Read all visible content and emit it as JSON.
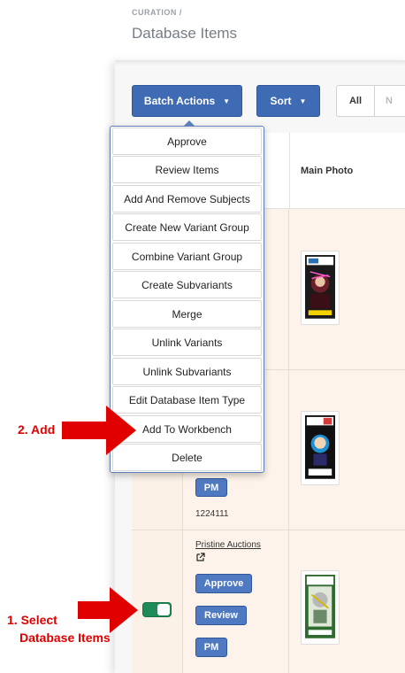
{
  "header": {
    "breadcrumb": "CURATION /",
    "title": "Database Items"
  },
  "toolbar": {
    "batch_actions": "Batch Actions",
    "sort": "Sort",
    "filter_all": "All",
    "filter_next": "N"
  },
  "table": {
    "main_photo_header": "Main Photo",
    "rows": [
      {
        "pm": "PM",
        "id": "1224111"
      },
      {
        "seller": "Pristine Auctions",
        "approve": "Approve",
        "review": "Review",
        "pm": "PM"
      }
    ]
  },
  "batch_menu": {
    "items": [
      "Approve",
      "Review Items",
      "Add And Remove Subjects",
      "Create New Variant Group",
      "Combine Variant Group",
      "Create Subvariants",
      "Merge",
      "Unlink Variants",
      "Unlink Subvariants",
      "Edit Database Item Type",
      "Add To Workbench",
      "Delete"
    ]
  },
  "annotations": {
    "step2": "2. Add",
    "step1_line1": "1. Select",
    "step1_line2": "Database Items",
    "arrow_color": "#e00000"
  },
  "colors": {
    "primary_button": "#3e6bb3",
    "toggle_on": "#1e8a55",
    "row_bg": "#fdf3ea"
  },
  "icons": {
    "caret": "caret-down-icon",
    "external_link": "external-link-icon"
  }
}
